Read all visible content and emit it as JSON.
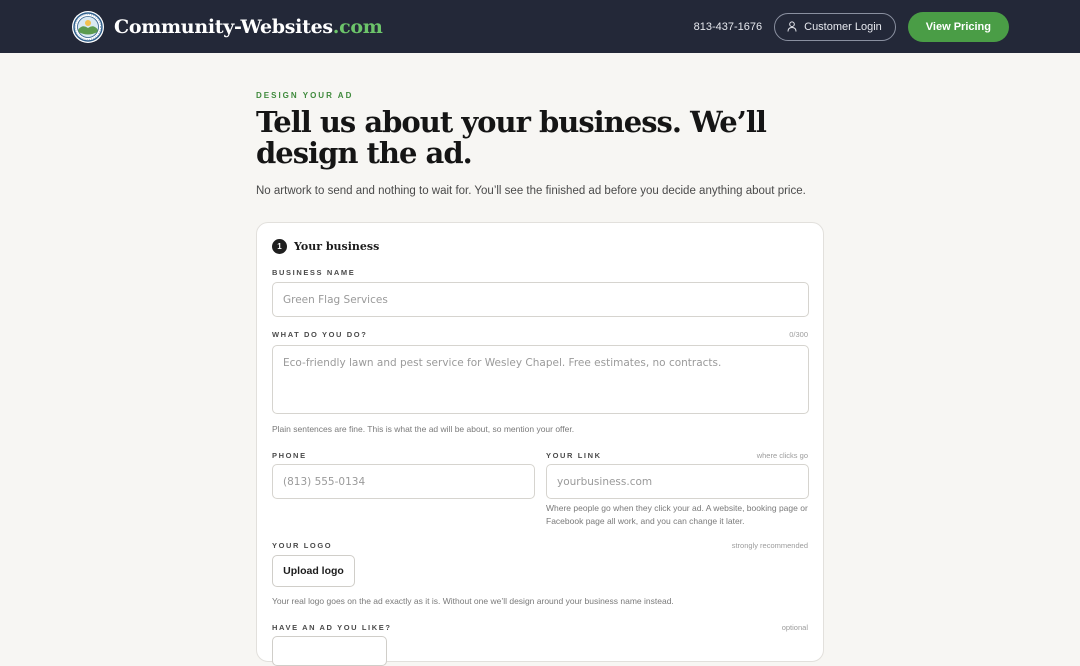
{
  "header": {
    "brand_main": "Community-Websites",
    "brand_tld": ".com",
    "phone": "813-437-1676",
    "login_label": "Customer Login",
    "pricing_label": "View Pricing",
    "accent_color": "#4a9d46"
  },
  "intro": {
    "eyebrow": "DESIGN YOUR AD",
    "headline": "Tell us about your business. We’ll design the ad.",
    "subline": "No artwork to send and nothing to wait for. You’ll see the finished ad before you decide anything about price."
  },
  "form": {
    "step_number": "1",
    "step_title": "Your business",
    "business_name": {
      "label": "BUSINESS NAME",
      "placeholder": "Green Flag Services",
      "value": ""
    },
    "description": {
      "label": "WHAT DO YOU DO?",
      "counter": "0/300",
      "placeholder": "Eco-friendly lawn and pest service for Wesley Chapel. Free estimates, no contracts.",
      "value": "",
      "hint": "Plain sentences are fine. This is what the ad will be about, so mention your offer."
    },
    "phone": {
      "label": "PHONE",
      "placeholder": "(813) 555-0134",
      "value": ""
    },
    "link": {
      "label": "YOUR LINK",
      "aside": "where clicks go",
      "placeholder": "yourbusiness.com",
      "value": "",
      "hint": "Where people go when they click your ad. A website, booking page or Facebook page all work, and you can change it later."
    },
    "logo": {
      "label": "YOUR LOGO",
      "aside": "strongly recommended",
      "button_label": "Upload logo",
      "hint": "Your real logo goes on the ad exactly as it is. Without one we’ll design around your business name instead."
    },
    "sample_ad": {
      "label": "HAVE AN AD YOU LIKE?",
      "aside": "optional"
    }
  },
  "icons": {
    "user": "user-icon",
    "seal": "community-seal-icon"
  }
}
